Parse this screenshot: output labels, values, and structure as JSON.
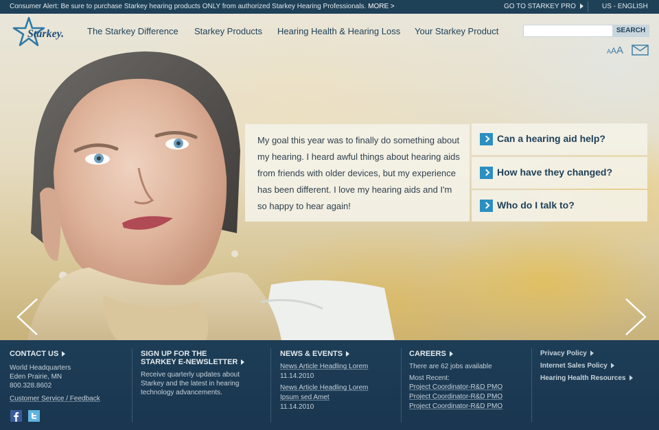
{
  "topbar": {
    "alert_text": "Consumer Alert: Be sure to purchase Starkey hearing products ONLY from authorized Starkey Hearing Professionals.",
    "alert_more": "MORE >",
    "pro_link": "GO TO STARKEY PRO",
    "locale": "US - ENGLISH"
  },
  "header": {
    "logo_text": "Starkey.",
    "nav": [
      "The Starkey Difference",
      "Starkey Products",
      "Hearing Health & Hearing Loss",
      "Your Starkey Product"
    ],
    "search": {
      "placeholder": "",
      "button": "SEARCH"
    },
    "text_size": {
      "small": "A",
      "medium": "A",
      "large": "A"
    },
    "icons": {
      "email": "envelope-icon"
    }
  },
  "hero": {
    "quote": "My goal this year was to finally do something about my hearing. I heard awful things about hearing aids from friends with older devices, but my experience has been different. I love my hearing aids and I'm so happy to hear again!",
    "ctas": [
      "Can a hearing aid help?",
      "How have they changed?",
      "Who do I talk to?"
    ],
    "icons": {
      "prev": "chevron-left-icon",
      "next": "chevron-right-icon"
    }
  },
  "footer": {
    "contact": {
      "heading": "CONTACT US",
      "lines": [
        "World Headquarters",
        "Eden Prairie, MN",
        "800.328.8602"
      ],
      "link": "Customer Service / Feedback",
      "social": [
        "facebook-icon",
        "twitter-icon"
      ]
    },
    "newsletter": {
      "heading_line1": "SIGN UP FOR THE",
      "heading_line2": "STARKEY E-NEWSLETTER",
      "lines": [
        "Receive quarterly updates about",
        "Starkey and the latest in hearing",
        "technology advancements."
      ]
    },
    "news": {
      "heading": "NEWS & EVENTS",
      "items": [
        {
          "title_lines": [
            "News Article Headling Lorem"
          ],
          "date": "11.14.2010"
        },
        {
          "title_lines": [
            "News Article Headling Lorem",
            "Ipsum sed Amet"
          ],
          "date": "11.14.2010"
        }
      ]
    },
    "careers": {
      "heading": "CAREERS",
      "count_text": "There are 62 jobs available",
      "recent_label": "Most Recent:",
      "jobs": [
        "Project Coordinator-R&D PMO",
        "Project Coordinator-R&D PMO",
        "Project Coordinator-R&D PMO"
      ]
    },
    "policies": [
      "Privacy Policy",
      "Internet Sales Policy",
      "Hearing Health Resources"
    ]
  },
  "colors": {
    "navy": "#1f4158",
    "footer_bg": "#1c3a52",
    "accent_blue": "#2b8fc2",
    "panel": "#f4f2e8"
  }
}
